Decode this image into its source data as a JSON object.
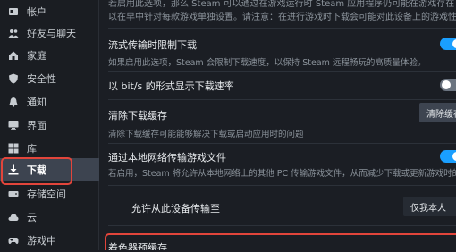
{
  "sidebar": {
    "items": [
      {
        "label": "帐户",
        "icon": "account-icon"
      },
      {
        "label": "好友与聊天",
        "icon": "friends-icon"
      },
      {
        "label": "家庭",
        "icon": "family-icon"
      },
      {
        "label": "安全性",
        "icon": "shield-icon"
      },
      {
        "label": "通知",
        "icon": "bell-icon"
      },
      {
        "label": "界面",
        "icon": "monitor-icon"
      },
      {
        "label": "库",
        "icon": "library-grid-icon"
      },
      {
        "label": "下载",
        "icon": "download-icon",
        "active": true
      },
      {
        "label": "存储空间",
        "icon": "storage-icon"
      },
      {
        "label": "云",
        "icon": "cloud-icon"
      },
      {
        "label": "游戏中",
        "icon": "gamepad-icon"
      }
    ]
  },
  "main": {
    "top_text_1": "若启用此选项，那么 Steam 可以通过在游戏运行时 Steam 应用程序仍可能在游戏存在",
    "top_text_2": "以在早中针对每款游戏单独设置。请注意：在进行游戏时下载会可能对此设备上的游戏性能产生严重影响",
    "streaming_throttle": {
      "title": "流式传输时限制下载",
      "desc": "如果启用此选项，Steam 会限制下载速度，以保持 Steam 远程畅玩的高质量体验。",
      "enabled": true
    },
    "bits_display": {
      "title": "以 bit/s 的形式显示下载速率",
      "enabled": false
    },
    "clear_cache": {
      "title": "清除下载缓存",
      "desc": "清除下载缓存可能能够解决下载或启动应用时的问题",
      "button": "清除缓存"
    },
    "local_transfer": {
      "title": "通过本地网络传输游戏文件",
      "desc": "若启用，Steam 将允许从本地网络上的其他 PC 传输游戏文件，从而减少下载或更新游戏时的互联网流",
      "enabled": true
    },
    "allow_from": {
      "label": "允许从此设备传输至",
      "value": "仅我本人"
    },
    "shader_cache": {
      "title": "着色器预缓存"
    }
  }
}
